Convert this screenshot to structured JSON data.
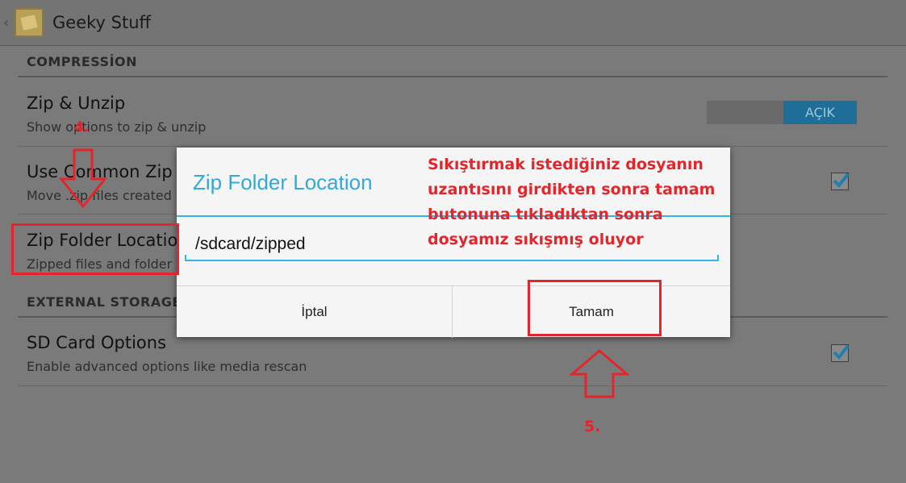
{
  "app": {
    "title": "Geeky Stuff",
    "back_icon": "chevron-left-icon",
    "logo_icon": "app-logo-icon"
  },
  "sections": {
    "compression": "COMPRESSİON",
    "external_storage": "EXTERNAL STORAGE"
  },
  "prefs": {
    "zip_unzip": {
      "title": "Zip & Unzip",
      "summary": "Show options to zip & unzip",
      "toggle_label": "AÇIK",
      "toggle_on": true
    },
    "use_common_zip": {
      "title": "Use Common Zip",
      "summary": "Move .zip files created",
      "checked": true
    },
    "zip_folder_location": {
      "title": "Zip Folder Location",
      "summary": "Zipped files and folder"
    },
    "sd_card_options": {
      "title": "SD Card Options",
      "summary": "Enable advanced options like media rescan",
      "checked": true
    }
  },
  "dialog": {
    "title": "Zip Folder Location",
    "input_value": "/sdcard/zipped",
    "cancel_label": "İptal",
    "ok_label": "Tamam"
  },
  "annotations": {
    "step4": "4.",
    "step5": "5.",
    "note_line1": "Sıkıştırmak istediğiniz dosyanın",
    "note_line2": "uzantısını girdikten sonra tamam",
    "note_line3": "butonuna tıkladıktan sonra",
    "note_line4": "dosyamız sıkışmış oluyor",
    "color": "#e3262c"
  },
  "colors": {
    "accent": "#33b5e5",
    "toggle_on": "#1e6f97",
    "dim_background": "#7a7a7a"
  }
}
